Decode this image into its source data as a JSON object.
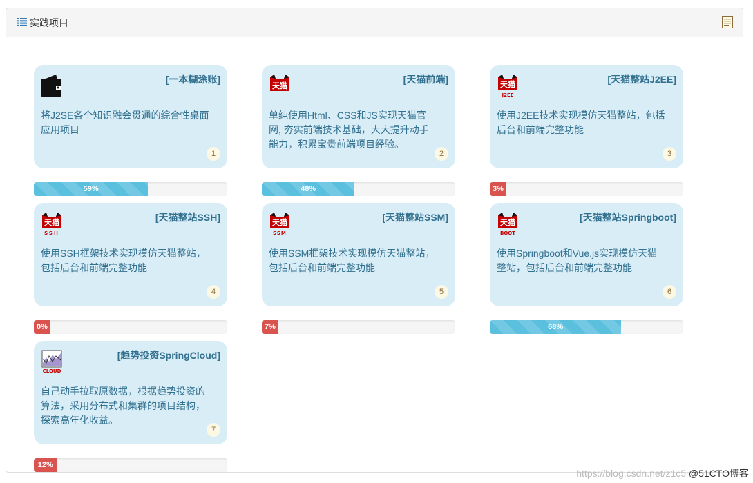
{
  "panel": {
    "title": "实践项目",
    "heading_icon": "list-icon",
    "corner_icon": "note-icon"
  },
  "projects": [
    {
      "title": "[一本糊涂账]",
      "logo": "wallet-icon",
      "description": "将J2SE各个知识融会贯通的综合性桌面应用项目",
      "number": "1",
      "progress_label": "59%",
      "progress": 59,
      "status": "info"
    },
    {
      "title": "[天猫前端]",
      "logo": "tmall-icon",
      "logo_caption": "",
      "description": "单纯使用Html、CSS和JS实现天猫官网, 夯实前端技术基础，大大提升动手能力，积累宝贵前端项目经验。",
      "number": "2",
      "progress_label": "48%",
      "progress": 48,
      "status": "info"
    },
    {
      "title": "[天猫整站J2EE]",
      "logo": "tmall-icon",
      "logo_caption": "J2EE",
      "description": "使用J2EE技术实现模仿天猫整站，包括后台和前端完整功能",
      "number": "3",
      "progress_label": "3%",
      "progress": 3,
      "status": "danger"
    },
    {
      "title": "[天猫整站SSH]",
      "logo": "tmall-icon",
      "logo_caption": "SSH",
      "description": "使用SSH框架技术实现模仿天猫整站，包括后台和前端完整功能",
      "number": "4",
      "progress_label": "0%",
      "progress": 0,
      "status": "danger"
    },
    {
      "title": "[天猫整站SSM]",
      "logo": "tmall-icon",
      "logo_caption": "SSM",
      "description": "使用SSM框架技术实现模仿天猫整站，包括后台和前端完整功能",
      "number": "5",
      "progress_label": "7%",
      "progress": 7,
      "status": "danger"
    },
    {
      "title": "[天猫整站Springboot]",
      "logo": "tmall-icon",
      "logo_caption": "BOOT",
      "description": "使用Springboot和Vue.js实现模仿天猫整站，包括后台和前端完整功能",
      "number": "6",
      "progress_label": "68%",
      "progress": 68,
      "status": "info"
    },
    {
      "title": "[趋势投资SpringCloud]",
      "logo": "chart-cloud-icon",
      "logo_caption": "CLOUD",
      "description": "自己动手拉取原数据，根据趋势投资的算法，采用分布式和集群的项目结构，探索高年化收益。",
      "number": "7",
      "progress_label": "12%",
      "progress": 12,
      "status": "danger"
    }
  ],
  "watermark": {
    "url": "https://blog.csdn.net/z1c5",
    "brand": "@51CTO博客"
  },
  "colors": {
    "card_bg": "#d9edf7",
    "card_text": "#31708f",
    "progress_info": "#5bc0de",
    "progress_danger": "#d9534f",
    "tmall_red": "#c40000"
  }
}
